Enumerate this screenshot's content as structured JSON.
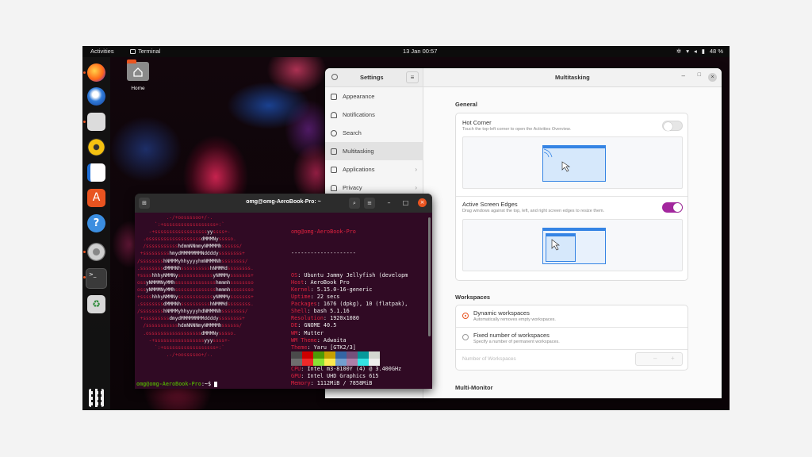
{
  "topbar": {
    "activities": "Activities",
    "app_name": "Terminal",
    "clock": "13 Jan  00:57",
    "battery": "48 %"
  },
  "desktop": {
    "home_label": "Home"
  },
  "dock": {
    "items": [
      "firefox-icon",
      "thunderbird-icon",
      "files-icon",
      "rhythmbox-icon",
      "writer-icon",
      "software-icon",
      "help-icon",
      "settings-icon",
      "terminal-icon",
      "trash-icon",
      "app-grid-icon"
    ]
  },
  "settings": {
    "title": "Settings",
    "panel_title": "Multitasking",
    "sidebar": [
      {
        "label": "Appearance"
      },
      {
        "label": "Notifications"
      },
      {
        "label": "Search"
      },
      {
        "label": "Multitasking"
      },
      {
        "label": "Applications"
      },
      {
        "label": "Privacy"
      }
    ],
    "general_title": "General",
    "hot_corner_title": "Hot Corner",
    "hot_corner_sub": "Touch the top-left corner to open the Activities Overview.",
    "hot_corner_on": false,
    "edges_title": "Active Screen Edges",
    "edges_sub": "Drag windows against the top, left, and right screen edges to resize them.",
    "edges_on": true,
    "workspaces_title": "Workspaces",
    "dynamic_title": "Dynamic workspaces",
    "dynamic_sub": "Automatically removes empty workspaces.",
    "fixed_title": "Fixed number of workspaces",
    "fixed_sub": "Specify a number of permanent workspaces.",
    "number_label": "Number of Workspaces",
    "multimonitor_title": "Multi-Monitor"
  },
  "terminal": {
    "title": "omg@omg-AeroBook-Pro: ~",
    "user_host": "omg@omg-AeroBook-Pro",
    "separator": "--------------------",
    "info": [
      {
        "k": "OS",
        "v": "Ubuntu Jammy Jellyfish (developm"
      },
      {
        "k": "Host",
        "v": "AeroBook Pro"
      },
      {
        "k": "Kernel",
        "v": "5.15.0-16-generic"
      },
      {
        "k": "Uptime",
        "v": "22 secs"
      },
      {
        "k": "Packages",
        "v": "1676 (dpkg), 10 (flatpak),"
      },
      {
        "k": "Shell",
        "v": "bash 5.1.16"
      },
      {
        "k": "Resolution",
        "v": "1920x1080"
      },
      {
        "k": "DE",
        "v": "GNOME 40.5"
      },
      {
        "k": "WM",
        "v": "Mutter"
      },
      {
        "k": "WM Theme",
        "v": "Adwaita"
      },
      {
        "k": "Theme",
        "v": "Yaru [GTK2/3]"
      },
      {
        "k": "Icons",
        "v": "Yaru [GTK2/3]"
      },
      {
        "k": "Terminal",
        "v": "gnome-terminal"
      },
      {
        "k": "CPU",
        "v": "Intel m3-8100Y (4) @ 3.400GHz"
      },
      {
        "k": "GPU",
        "v": "Intel UHD Graphics 615"
      },
      {
        "k": "Memory",
        "v": "1112MiB / 7858MiB"
      }
    ],
    "palette": [
      "#4a4a4a",
      "#cc0000",
      "#4e9a06",
      "#c4a000",
      "#3465a4",
      "#75507b",
      "#06989a",
      "#d3d7cf"
    ],
    "palette_bright": [
      "#6e6e6e",
      "#ef2929",
      "#8ae234",
      "#fce94f",
      "#729fcf",
      "#ad7fa8",
      "#34e2e2",
      "#eeeeec"
    ],
    "prompt_user": "omg@omg-AeroBook-Pro",
    "prompt_rest": ":~$ "
  }
}
